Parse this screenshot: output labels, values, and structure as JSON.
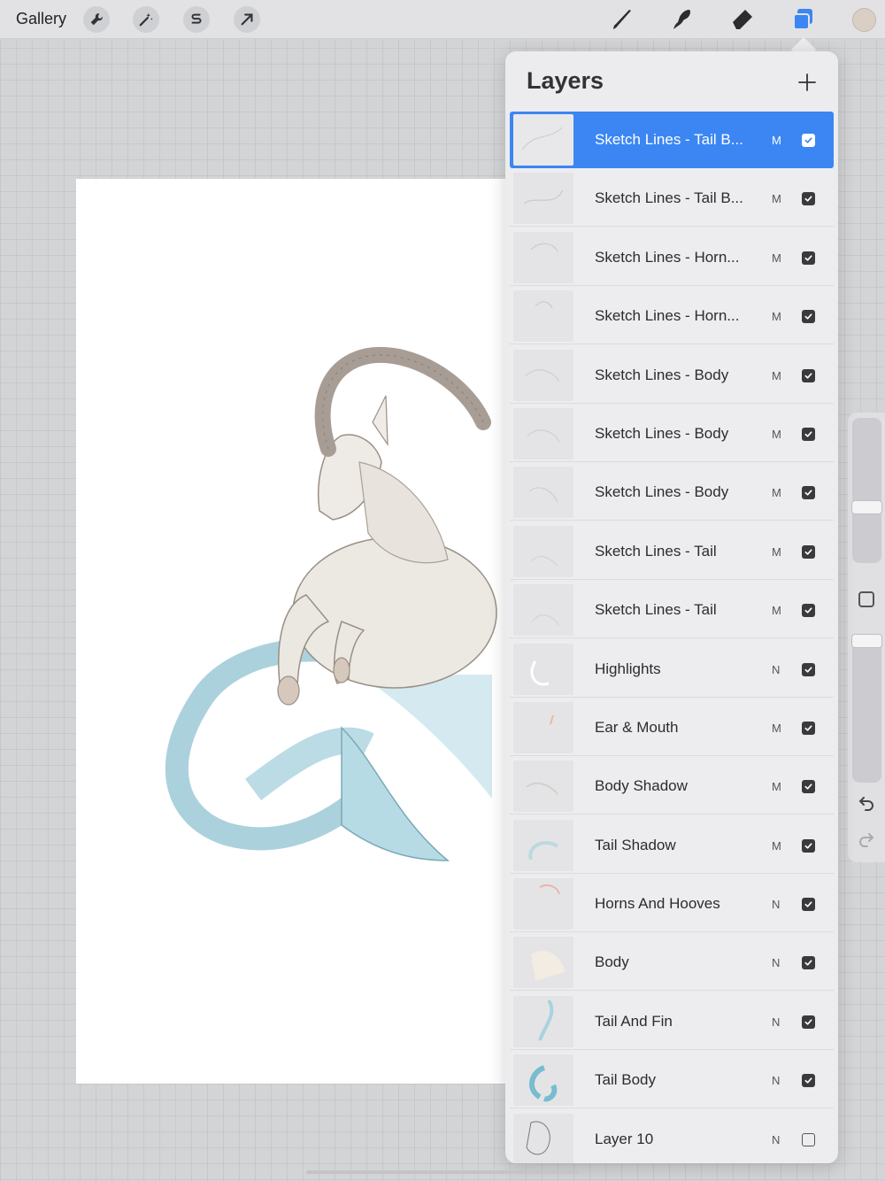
{
  "toolbar": {
    "gallery_label": "Gallery",
    "left_tools": [
      {
        "name": "wrench-icon"
      },
      {
        "name": "magic-wand-icon"
      },
      {
        "name": "selection-s-icon"
      },
      {
        "name": "transform-arrow-icon"
      }
    ],
    "right_tools": [
      {
        "name": "brush-icon"
      },
      {
        "name": "smudge-icon"
      },
      {
        "name": "eraser-icon"
      },
      {
        "name": "layers-icon"
      }
    ],
    "accent_color": "#3b86f2",
    "current_color": "#d9cfc4"
  },
  "layers_panel": {
    "title": "Layers",
    "add_icon": "plus-icon",
    "layers": [
      {
        "name": "Sketch Lines - Tail B...",
        "blend": "M",
        "visible": true,
        "selected": true
      },
      {
        "name": "Sketch Lines - Tail B...",
        "blend": "M",
        "visible": true,
        "selected": false
      },
      {
        "name": "Sketch Lines - Horn...",
        "blend": "M",
        "visible": true,
        "selected": false
      },
      {
        "name": "Sketch Lines - Horn...",
        "blend": "M",
        "visible": true,
        "selected": false
      },
      {
        "name": "Sketch Lines - Body",
        "blend": "M",
        "visible": true,
        "selected": false
      },
      {
        "name": "Sketch Lines - Body",
        "blend": "M",
        "visible": true,
        "selected": false
      },
      {
        "name": "Sketch Lines - Body",
        "blend": "M",
        "visible": true,
        "selected": false
      },
      {
        "name": "Sketch Lines - Tail",
        "blend": "M",
        "visible": true,
        "selected": false
      },
      {
        "name": "Sketch Lines - Tail",
        "blend": "M",
        "visible": true,
        "selected": false
      },
      {
        "name": "Highlights",
        "blend": "N",
        "visible": true,
        "selected": false
      },
      {
        "name": "Ear & Mouth",
        "blend": "M",
        "visible": true,
        "selected": false
      },
      {
        "name": "Body Shadow",
        "blend": "M",
        "visible": true,
        "selected": false
      },
      {
        "name": "Tail Shadow",
        "blend": "M",
        "visible": true,
        "selected": false
      },
      {
        "name": "Horns And Hooves",
        "blend": "N",
        "visible": true,
        "selected": false
      },
      {
        "name": "Body",
        "blend": "N",
        "visible": true,
        "selected": false
      },
      {
        "name": "Tail And Fin",
        "blend": "N",
        "visible": true,
        "selected": false
      },
      {
        "name": "Tail Body",
        "blend": "N",
        "visible": true,
        "selected": false
      },
      {
        "name": "Layer 10",
        "blend": "N",
        "visible": false,
        "selected": false
      }
    ]
  },
  "sidebar": {
    "brush_size_icon": "brush-size-slider",
    "opacity_icon": "opacity-slider",
    "modify_icon": "square-modify-icon",
    "undo_icon": "undo-icon",
    "redo_icon": "redo-icon"
  }
}
